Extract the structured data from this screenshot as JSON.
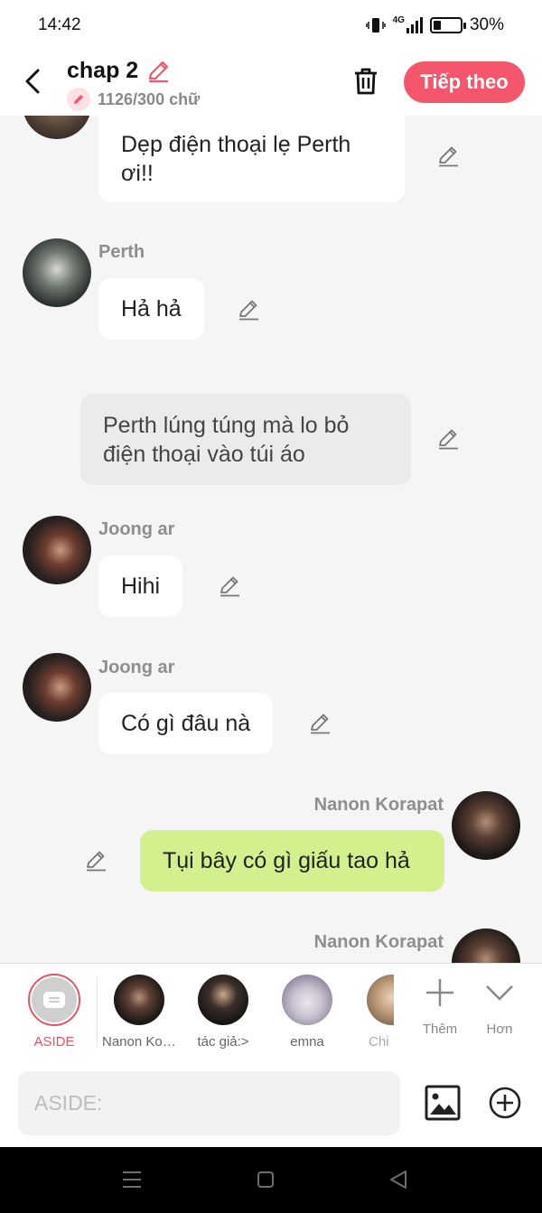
{
  "status": {
    "time": "14:42",
    "network": "4G",
    "battery": "30%",
    "battery_level": 0.3
  },
  "header": {
    "title": "chap 2",
    "word_count": "1126/300 chữ",
    "next_label": "Tiếp theo"
  },
  "messages": [
    {
      "type": "left",
      "sender": "",
      "text": "Dẹp điện thoại lẹ Perth ơi!!",
      "lines": [
        "Dẹp điện thoại lẹ Perth",
        "ơi!!"
      ]
    },
    {
      "type": "left",
      "sender": "Perth",
      "text": "Hả hả"
    },
    {
      "type": "aside",
      "lines": [
        "Perth lúng túng mà lo bỏ",
        "điện thoại vào túi áo"
      ]
    },
    {
      "type": "left",
      "sender": "Joong ar",
      "text": "Hihi"
    },
    {
      "type": "left",
      "sender": "Joong ar",
      "text": "Có gì đâu nà"
    },
    {
      "type": "right",
      "sender": "Nanon Korapat",
      "text": "Tụi bây có gì giấu tao hả"
    },
    {
      "type": "right",
      "sender": "Nanon Korapat",
      "text": ""
    }
  ],
  "characters": [
    {
      "label": "ASIDE",
      "active": true
    },
    {
      "label": "Nanon Korapat"
    },
    {
      "label": "tác giả:>"
    },
    {
      "label": "emna"
    },
    {
      "label": "Chi"
    }
  ],
  "actions": {
    "add_label": "Thêm",
    "more_label": "Hơn"
  },
  "composer": {
    "placeholder": "ASIDE:"
  },
  "colors": {
    "accent": "#f4566b",
    "my_bubble": "#d3f08e",
    "aside_bubble": "#ebebeb"
  }
}
